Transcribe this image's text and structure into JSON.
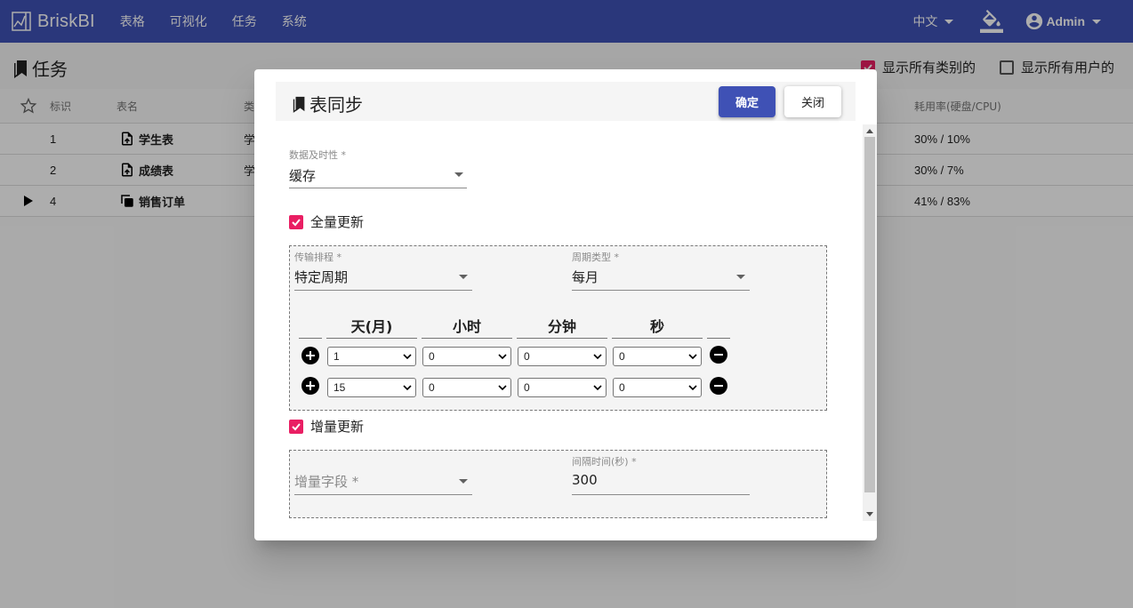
{
  "app": {
    "name": "BriskBI",
    "nav": [
      "表格",
      "可视化",
      "任务",
      "系统"
    ],
    "language": "中文",
    "user": "Admin"
  },
  "page": {
    "title": "任务",
    "show_all_categories": {
      "label": "显示所有类别的",
      "checked": true
    },
    "show_all_users": {
      "label": "显示所有用户的",
      "checked": false
    }
  },
  "table": {
    "headers": {
      "id": "标识",
      "name": "表名",
      "category": "类",
      "usage": "耗用率(硬盘/CPU)"
    },
    "rows": [
      {
        "id": "1",
        "name": "学生表",
        "category": "学",
        "usage": "30% / 10%",
        "icon": "upload-file-icon"
      },
      {
        "id": "2",
        "name": "成绩表",
        "category": "学",
        "usage": "30% / 7%",
        "icon": "upload-file-icon"
      },
      {
        "id": "4",
        "name": "销售订单",
        "category": "",
        "usage": "41% / 83%",
        "icon": "copy-icon"
      }
    ]
  },
  "dialog": {
    "title": "表同步",
    "ok": "确定",
    "close": "关闭",
    "timeliness": {
      "label": "数据及时性 *",
      "value": "缓存"
    },
    "full_update": {
      "label": "全量更新",
      "checked": true
    },
    "schedule": {
      "label": "传输排程 *",
      "value": "特定周期"
    },
    "cycle": {
      "label": "周期类型 *",
      "value": "每月"
    },
    "columns": [
      "天(月)",
      "小时",
      "分钟",
      "秒"
    ],
    "rows": [
      [
        "1",
        "0",
        "0",
        "0"
      ],
      [
        "15",
        "0",
        "0",
        "0"
      ]
    ],
    "incremental_update": {
      "label": "增量更新",
      "checked": true
    },
    "incremental_field": {
      "placeholder": "增量字段 *"
    },
    "interval": {
      "label": "间隔时间(秒) *",
      "value": "300"
    }
  },
  "colors": {
    "primary": "#3f51b5",
    "accent": "#e91e63"
  }
}
